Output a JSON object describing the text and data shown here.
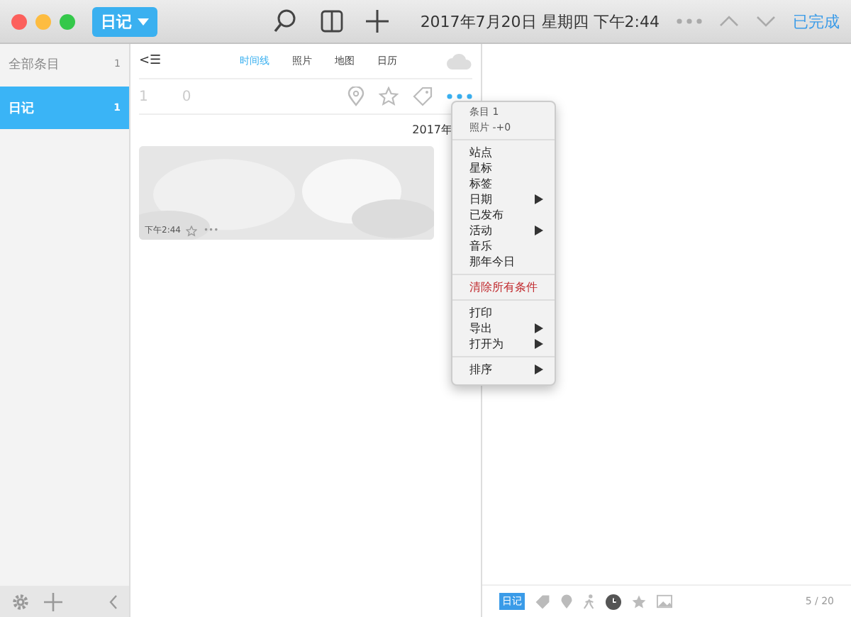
{
  "toolbar": {
    "journal": "日记",
    "date": "2017年7月20日 星期四 下午2:44",
    "done": "已完成"
  },
  "sidebar": {
    "items": [
      {
        "label": "全部条目",
        "count": "1",
        "selected": false
      },
      {
        "label": "日记",
        "count": "1",
        "selected": true
      }
    ]
  },
  "middle": {
    "back": "<☰",
    "tabs": [
      {
        "label": "时间线",
        "selected": true
      },
      {
        "label": "照片",
        "selected": false
      },
      {
        "label": "地图",
        "selected": false
      },
      {
        "label": "日历",
        "selected": false
      }
    ],
    "counts": [
      "1",
      "0"
    ],
    "year": "2017年",
    "card": {
      "time": "下午2:44",
      "more": "•••"
    }
  },
  "menu": {
    "header": [
      "条目 1",
      "照片 -+0"
    ],
    "groups": [
      [
        {
          "label": "站点",
          "submenu": false,
          "kind": "normal"
        },
        {
          "label": "星标",
          "submenu": false,
          "kind": "normal"
        },
        {
          "label": "标签",
          "submenu": false,
          "kind": "normal"
        },
        {
          "label": "日期",
          "submenu": true,
          "kind": "normal"
        },
        {
          "label": "已发布",
          "submenu": false,
          "kind": "normal"
        },
        {
          "label": "活动",
          "submenu": true,
          "kind": "normal"
        },
        {
          "label": "音乐",
          "submenu": false,
          "kind": "normal"
        },
        {
          "label": "那年今日",
          "submenu": false,
          "kind": "normal"
        }
      ],
      [
        {
          "label": "清除所有条件",
          "submenu": false,
          "kind": "danger"
        }
      ],
      [
        {
          "label": "打印",
          "submenu": false,
          "kind": "normal"
        },
        {
          "label": "导出",
          "submenu": true,
          "kind": "normal"
        },
        {
          "label": "打开为",
          "submenu": true,
          "kind": "normal"
        }
      ],
      [
        {
          "label": "排序",
          "submenu": true,
          "kind": "normal"
        }
      ]
    ]
  },
  "footer": {
    "badge": "日记",
    "page": "5 / 20"
  }
}
